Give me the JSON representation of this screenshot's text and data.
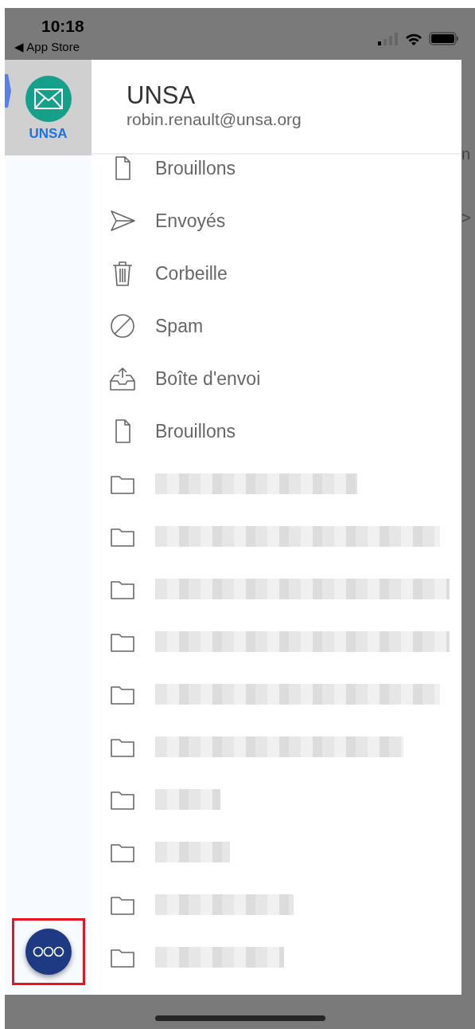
{
  "status_bar": {
    "time": "10:18",
    "back_link": "◀ App Store"
  },
  "accounts": [
    {
      "label": "UNSA",
      "selected": true
    }
  ],
  "drawer": {
    "title": "UNSA",
    "email": "robin.renault@unsa.org",
    "items": [
      {
        "kind": "drafts",
        "label": "Brouillons"
      },
      {
        "kind": "sent",
        "label": "Envoyés"
      },
      {
        "kind": "trash",
        "label": "Corbeille"
      },
      {
        "kind": "spam",
        "label": "Spam"
      },
      {
        "kind": "outbox",
        "label": "Boîte d'envoi"
      },
      {
        "kind": "drafts",
        "label": "Brouillons"
      },
      {
        "kind": "folder"
      },
      {
        "kind": "folder"
      },
      {
        "kind": "folder"
      },
      {
        "kind": "folder"
      },
      {
        "kind": "folder"
      },
      {
        "kind": "folder"
      },
      {
        "kind": "folder"
      },
      {
        "kind": "folder"
      },
      {
        "kind": "folder"
      },
      {
        "kind": "folder"
      }
    ]
  },
  "background_fragments": [
    "n",
    ">"
  ],
  "more_button": {
    "highlighted": true
  }
}
